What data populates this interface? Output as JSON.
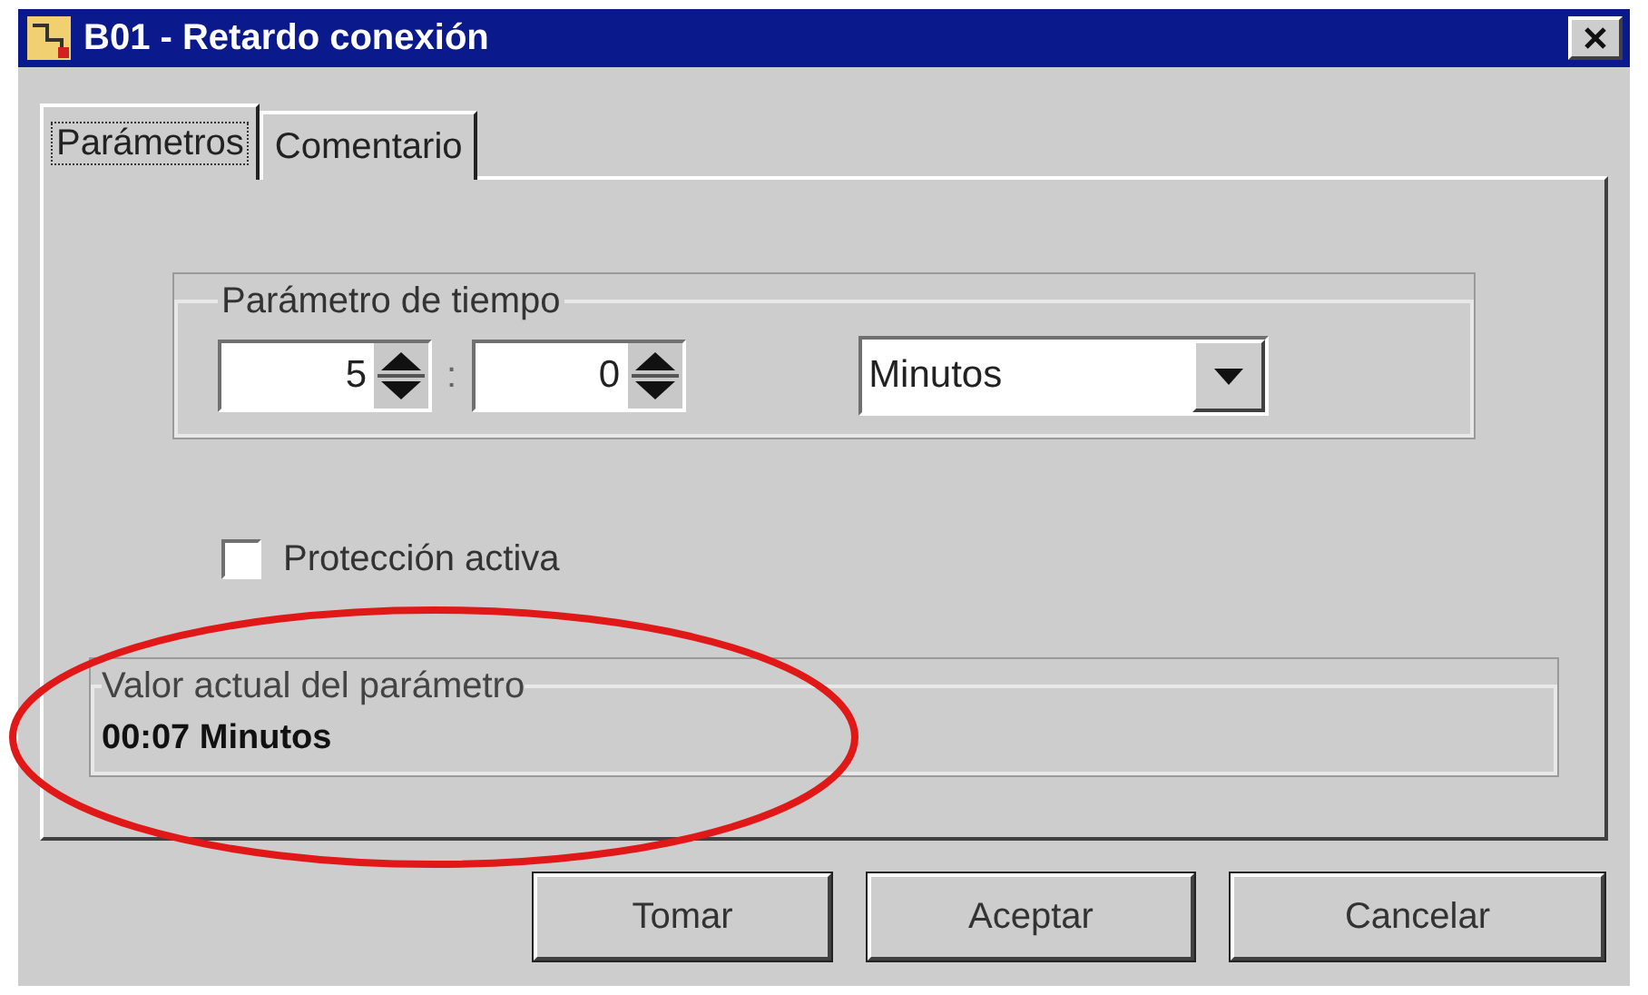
{
  "window": {
    "title": "B01 - Retardo conexión"
  },
  "tabs": [
    {
      "label": "Parámetros",
      "selected": true
    },
    {
      "label": "Comentario",
      "selected": false
    }
  ],
  "time_group": {
    "title": "Parámetro de tiempo",
    "fields": [
      {
        "value": "5"
      },
      {
        "value": "0"
      }
    ],
    "separator": ":",
    "unit": {
      "value": "Minutos"
    }
  },
  "checkbox": {
    "label": "Protección activa",
    "checked": false
  },
  "current_value": {
    "title": "Valor actual del parámetro",
    "value": "00:07 Minutos"
  },
  "buttons": [
    "Tomar",
    "Aceptar",
    "Cancelar"
  ]
}
